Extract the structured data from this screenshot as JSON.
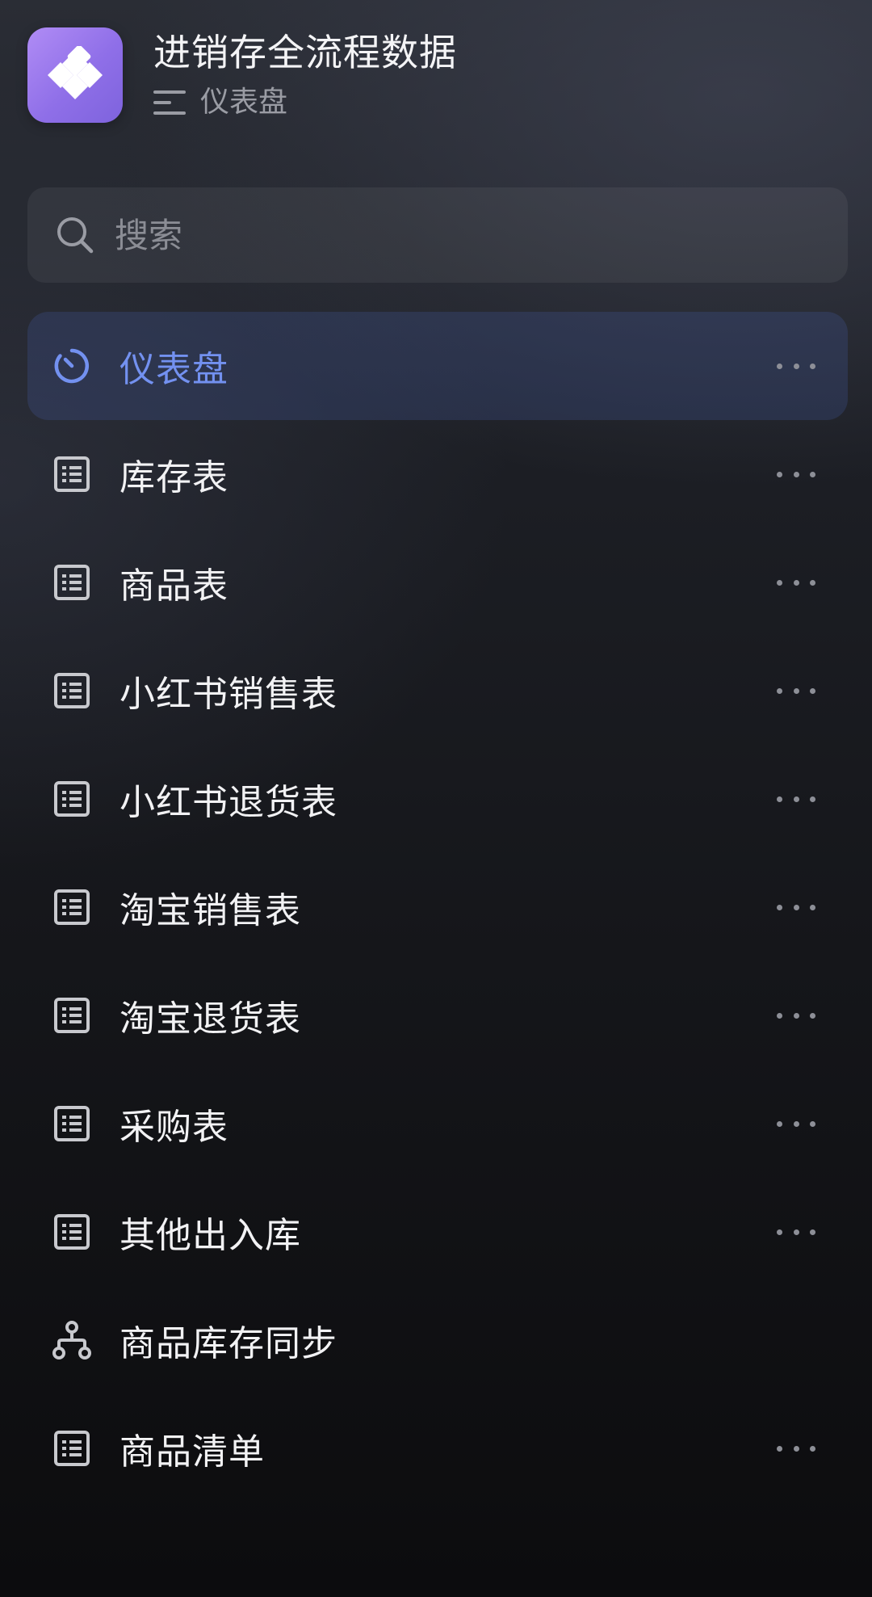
{
  "app": {
    "title": "进销存全流程数据",
    "subtitle": "仪表盘",
    "logo_icon": "diamond-grid-icon",
    "logo_color": "#9b7cf0"
  },
  "search": {
    "placeholder": "搜索",
    "value": ""
  },
  "nav": {
    "accent_color": "#7391f0",
    "items": [
      {
        "label": "仪表盘",
        "icon": "dashboard-icon",
        "active": true,
        "has_more": true
      },
      {
        "label": "库存表",
        "icon": "table-icon",
        "active": false,
        "has_more": true
      },
      {
        "label": "商品表",
        "icon": "table-icon",
        "active": false,
        "has_more": true
      },
      {
        "label": "小红书销售表",
        "icon": "table-icon",
        "active": false,
        "has_more": true
      },
      {
        "label": "小红书退货表",
        "icon": "table-icon",
        "active": false,
        "has_more": true
      },
      {
        "label": "淘宝销售表",
        "icon": "table-icon",
        "active": false,
        "has_more": true
      },
      {
        "label": "淘宝退货表",
        "icon": "table-icon",
        "active": false,
        "has_more": true
      },
      {
        "label": "采购表",
        "icon": "table-icon",
        "active": false,
        "has_more": true
      },
      {
        "label": "其他出入库",
        "icon": "table-icon",
        "active": false,
        "has_more": true
      },
      {
        "label": "商品库存同步",
        "icon": "workflow-icon",
        "active": false,
        "has_more": false
      },
      {
        "label": "商品清单",
        "icon": "table-icon",
        "active": false,
        "has_more": true
      }
    ]
  }
}
